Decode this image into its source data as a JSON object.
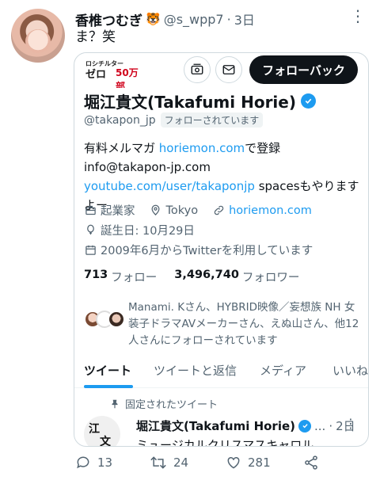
{
  "tweet": {
    "author_name": "香椎つむぎ",
    "author_emoji": "🐯",
    "author_handle": "@s_wpp7",
    "separator": "·",
    "time": "3日",
    "text": "ま？笑"
  },
  "card": {
    "thumb_lines": [
      "ロシチルター",
      "ゼロ",
      "50万部"
    ],
    "follow_back_label": "フォローバック",
    "profile_name": "堀江貴文(Takafumi Horie)",
    "profile_handle": "@takapon_jp",
    "follows_you_label": "フォローされています",
    "bio": {
      "part1": "有料メルマガ ",
      "link1": "horiemon.com",
      "part2": "で登録 info@takapon-jp.com ",
      "link2": "youtube.com/user/takaponjp",
      "part3": " spacesもやりますよー"
    },
    "meta": {
      "occupation": "起業家",
      "location": "Tokyo",
      "website": "horiemon.com",
      "birthday": "誕生日: 10月29日",
      "joined": "2009年6月からTwitterを利用しています"
    },
    "counts": {
      "following_value": "713",
      "following_label": "フォロー",
      "followers_value": "3,496,740",
      "followers_label": "フォロワー"
    },
    "followed_by_text": "Manami. Kさん、HYBRID映像／妄想族 NH 女装子ドラマAVメーカーさん、えぬ山さん、他12人さんにフォローされています",
    "tabs": [
      "ツイート",
      "ツイートと返信",
      "メディア",
      "いいね"
    ],
    "pinned_label": "固定されたツイート",
    "pinned_tweet": {
      "name": "堀江貴文(Takafumi Horie)",
      "ellipsis": "...",
      "separator": "·",
      "time": "2日",
      "text": "ミュージカルクリスマスキャロル"
    }
  },
  "actions": {
    "replies": "13",
    "retweets": "24",
    "likes": "281"
  },
  "colors": {
    "accent": "#1d9bf0",
    "text_primary": "#0f1419",
    "text_secondary": "#536471",
    "border": "#cfd9de"
  }
}
